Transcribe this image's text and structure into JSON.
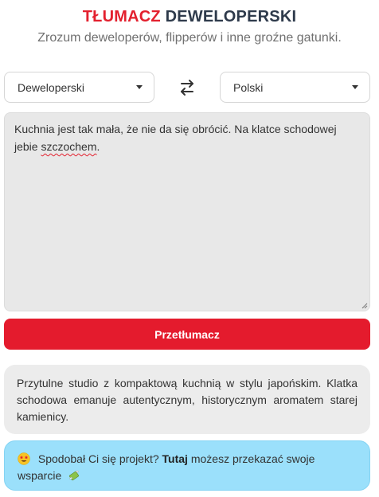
{
  "header": {
    "title_red": "TŁUMACZ",
    "title_dark": "DEWELOPERSKI",
    "subtitle": "Zrozum deweloperów, flipperów i inne groźne gatunki."
  },
  "languages": {
    "source": "Deweloperski",
    "target": "Polski"
  },
  "input": {
    "text_before": "Kuchnia jest tak mała, że nie da się obrócić. Na klatce schodowej jebie ",
    "text_misspelled": "szczochem",
    "text_after": "."
  },
  "translate_button": "Przetłumacz",
  "output": {
    "text": "Przytulne studio z kompaktową kuchnią w stylu japońskim. Klatka schodowa emanuje autentycznym, historycznym aromatem starej kamienicy."
  },
  "support": {
    "emoji_left": "star-struck-emoji",
    "text_before": " Spodobał Ci się projekt? ",
    "link": "Tutaj",
    "text_after": " możesz przekazać swoje wsparcie ",
    "emoji_right": "money-with-wings-emoji"
  },
  "colors": {
    "accent_red": "#e41b2d",
    "title_dark": "#2e3a4b",
    "input_bg": "#e8e8e8",
    "support_bg": "#9be0fb"
  }
}
